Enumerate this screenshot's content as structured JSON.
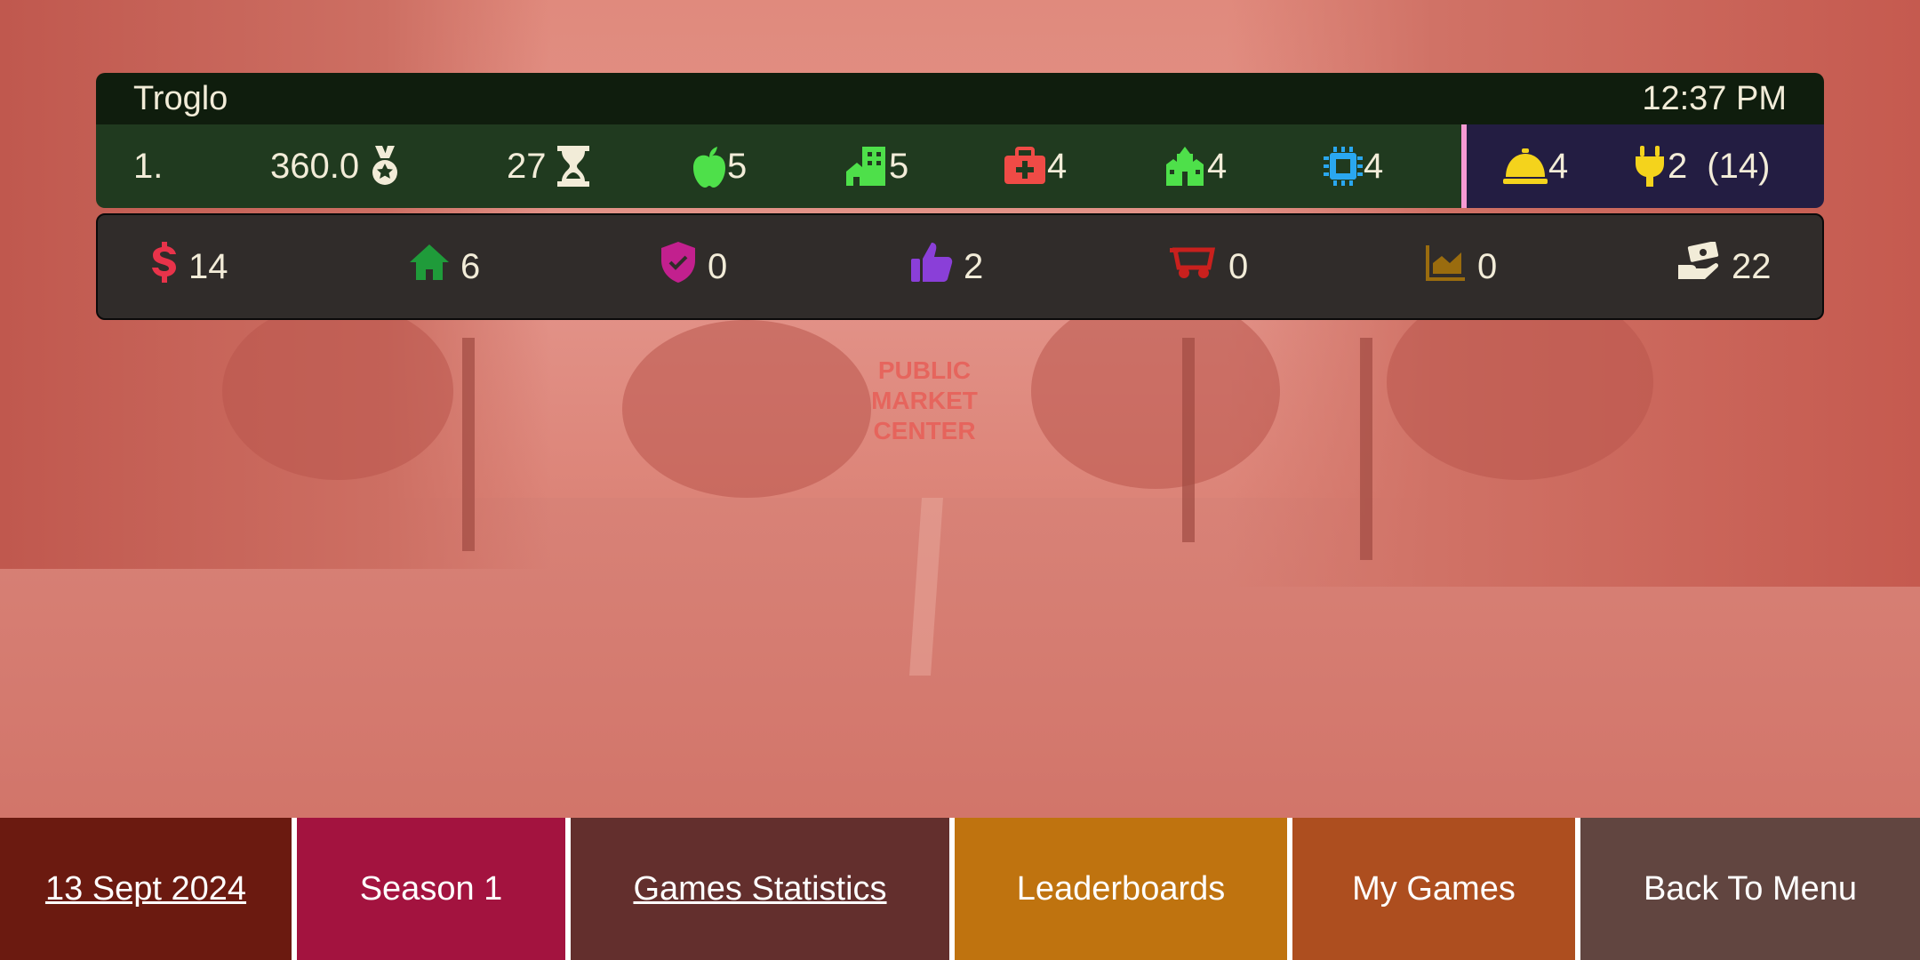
{
  "header": {
    "player_name": "Troglo",
    "time": "12:37 PM"
  },
  "stats": {
    "rank": "1.",
    "score": "360.0",
    "turns": "27",
    "food": "5",
    "housing": "5",
    "health": "4",
    "city": "4",
    "tech": "4",
    "service": "4",
    "power": "2",
    "power_total": "(14)"
  },
  "resources": {
    "money": "14",
    "homes": "6",
    "protection": "0",
    "approval": "2",
    "transport": "0",
    "growth": "0",
    "income": "22"
  },
  "nav": {
    "date": "13 Sept 2024",
    "season": "Season 1",
    "games_statistics": "Games Statistics",
    "leaderboards": "Leaderboards",
    "my_games": "My Games",
    "back_to_menu": "Back To Menu"
  },
  "colors": {
    "overlay": "#d97a6c",
    "title_bar": "#0f1d0d",
    "stats_bar": "#203a1f",
    "stats_alt": "#231d42",
    "resource_bar": "#302c2a",
    "nav_date": "#6b1a10",
    "nav_season": "#a3133f",
    "nav_stats": "#632f2d",
    "nav_leaderboards": "#bf730f",
    "nav_mygames": "#ad4e1f",
    "nav_back": "#614540"
  },
  "icons": {
    "score": "medal-icon",
    "turns": "hourglass-icon",
    "food": "apple-icon",
    "housing": "buildings-icon",
    "health": "medical-kit-icon",
    "city": "city-hall-icon",
    "tech": "chip-icon",
    "service": "service-bell-icon",
    "power": "plug-icon",
    "money": "dollar-icon",
    "homes": "house-icon",
    "protection": "shield-check-icon",
    "approval": "thumbs-up-icon",
    "transport": "wagon-icon",
    "growth": "area-chart-icon",
    "income": "hand-money-icon"
  }
}
